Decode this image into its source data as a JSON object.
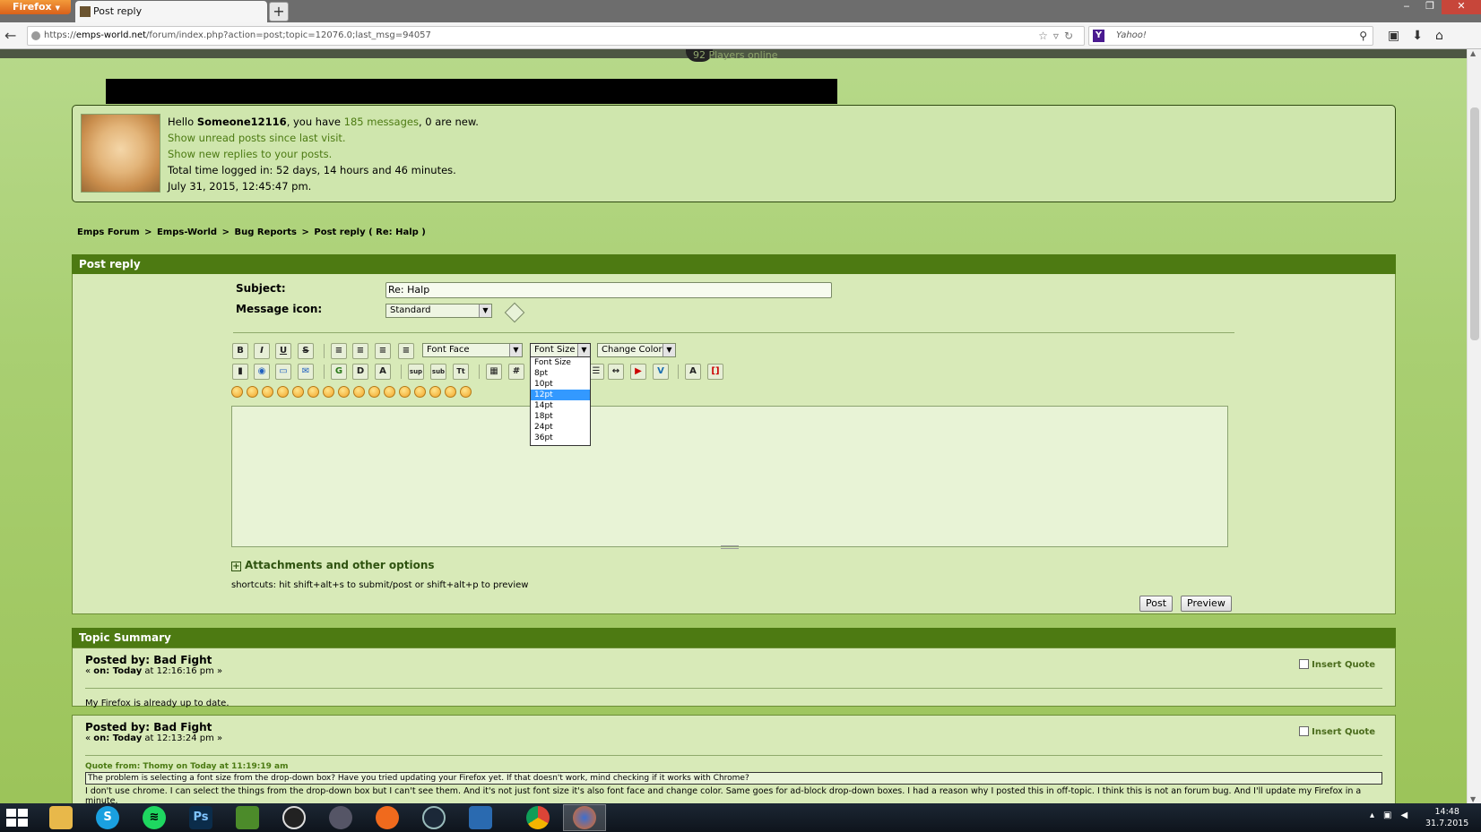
{
  "browser": {
    "menu_label": "Firefox",
    "tab_title": "Post reply",
    "url_prefix": "https://",
    "url_host": "emps-world.net",
    "url_path": "/forum/index.php?action=post;topic=12076.0;last_msg=94057",
    "search_placeholder": "Yahoo!",
    "search_engine_letter": "Y"
  },
  "header": {
    "players_online": "92 Players online"
  },
  "user": {
    "hello": "Hello ",
    "username": "Someone12116",
    "have": ", you have ",
    "messages_link": "185 messages",
    "new_count": ", 0 are new.",
    "unread_link": "Show unread posts since last visit.",
    "replies_link": "Show new replies to your posts.",
    "time_logged": "Total time logged in: 52 days, 14 hours and 46 minutes.",
    "datetime": "July 31, 2015, 12:45:47 pm."
  },
  "breadcrumb": [
    "Emps Forum",
    ">",
    "Emps-World",
    ">",
    "Bug Reports",
    ">",
    "Post reply ( Re: Halp )"
  ],
  "post_form": {
    "title": "Post reply",
    "subject_label": "Subject:",
    "subject_value": "Re: Halp",
    "icon_label": "Message icon:",
    "icon_value": "Standard",
    "font_face": "Font Face",
    "font_size": "Font Size",
    "change_color": "Change Color",
    "font_size_options": [
      "Font Size",
      "8pt",
      "10pt",
      "12pt",
      "14pt",
      "18pt",
      "24pt",
      "36pt"
    ],
    "font_size_highlighted": "12pt",
    "attachments_label": "Attachments and other options",
    "shortcuts": "shortcuts: hit shift+alt+s to submit/post or shift+alt+p to preview",
    "post_button": "Post",
    "preview_button": "Preview",
    "toolbar_row1": [
      "B",
      "I",
      "U",
      "S"
    ],
    "toolbar_sup": "sup",
    "toolbar_sub": "sub",
    "toolbar_tt": "Tt",
    "toolbar_hash": "#"
  },
  "summary": {
    "title": "Topic Summary",
    "insert_quote": "Insert Quote",
    "posts": [
      {
        "posted_by": "Posted by: Bad Fight",
        "on_label": "on: Today",
        "time": " at 12:16:16 pm »",
        "prefix": "« ",
        "body": "My Firefox is already up to date."
      },
      {
        "posted_by": "Posted by: Bad Fight",
        "on_label": "on: Today",
        "time": " at 12:13:24 pm »",
        "prefix": "« ",
        "quote_head": "Quote from: Thomy on Today at 11:19:19 am",
        "quote_text": "The problem is selecting a font size from the drop-down box? Have you tried updating your Firefox yet. If that doesn't work, mind checking if it works with Chrome?",
        "body": "I don't use chrome. I can select the things from the drop-down box but I can't see them. And it's not just font size it's also font face and change color. Same goes for ad-block drop-down boxes. I had a reason why I posted this in off-topic. I think this is not an forum bug. And I'll update my Firefox in a minute."
      }
    ]
  },
  "taskbar": {
    "time": "14:48",
    "date": "31.7.2015"
  }
}
